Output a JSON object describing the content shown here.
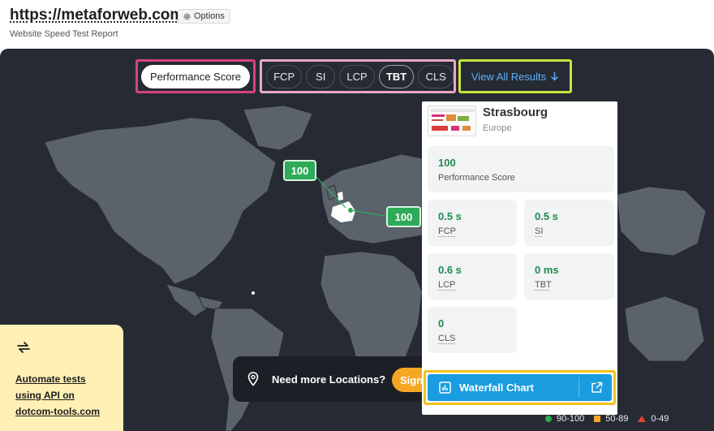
{
  "header": {
    "url": "https://metaforweb.com",
    "options_label": "Options",
    "subtitle": "Website Speed Test Report"
  },
  "tabs": {
    "performance_label": "Performance Score",
    "metrics": [
      "FCP",
      "SI",
      "LCP",
      "TBT",
      "CLS"
    ],
    "active_metric": "TBT",
    "view_all_label": "View All Results"
  },
  "map": {
    "markers": [
      {
        "label": "100",
        "status": "90-100"
      },
      {
        "label": "100",
        "status": "90-100"
      }
    ]
  },
  "panel": {
    "city": "Strasbourg",
    "region": "Europe",
    "performance": {
      "value": "100",
      "label": "Performance Score"
    },
    "metrics": [
      {
        "value": "0.5 s",
        "label": "FCP"
      },
      {
        "value": "0.5 s",
        "label": "SI"
      },
      {
        "value": "0.6 s",
        "label": "LCP"
      },
      {
        "value": "0 ms",
        "label": "TBT"
      },
      {
        "value": "0",
        "label": "CLS"
      }
    ],
    "waterfall_label": "Waterfall Chart"
  },
  "locations": {
    "prompt": "Need more Locations?",
    "signin_label": "Sign"
  },
  "promo": {
    "lines": [
      "Automate tests",
      "using API on",
      "dotcom-tools.com"
    ]
  },
  "legend": {
    "items": [
      "90-100",
      "50-89",
      "0-49"
    ]
  },
  "colors": {
    "good": "#2eaa58",
    "average": "#f5a623",
    "poor": "#e5412d",
    "link": "#5ab0ff",
    "button": "#1a9ce0"
  }
}
